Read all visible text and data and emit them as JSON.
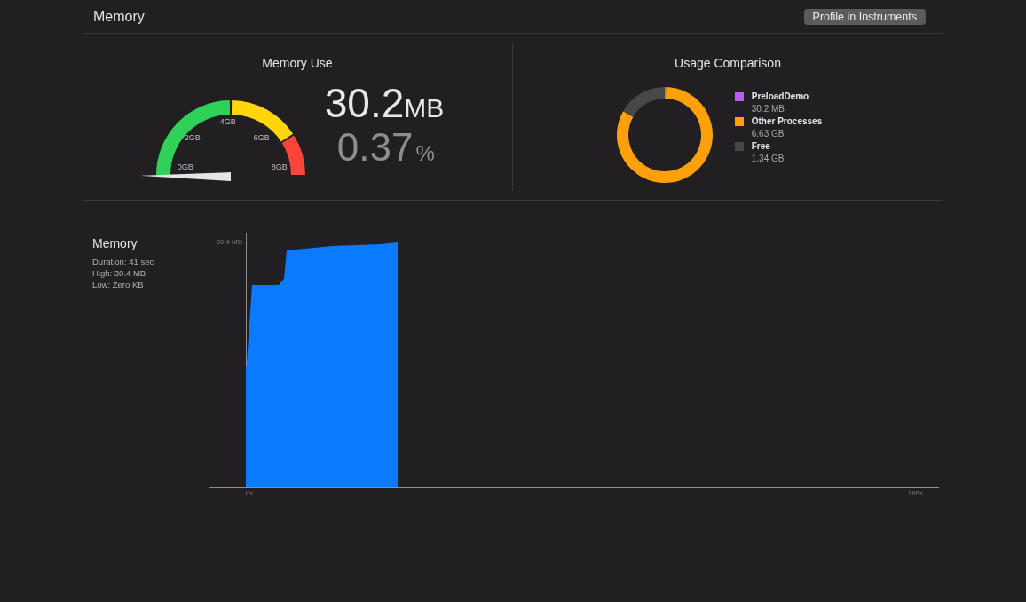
{
  "header": {
    "title": "Memory",
    "button": "Profile in Instruments"
  },
  "memory_use": {
    "title": "Memory Use",
    "gauge": {
      "level": 0.0037,
      "ticks": [
        "0GB",
        "2GB",
        "4GB",
        "6GB",
        "8GB"
      ]
    },
    "value": "30.2",
    "unit": "MB",
    "percent": "0.37",
    "percent_unit": "%"
  },
  "usage_comparison": {
    "title": "Usage Comparison",
    "chart_data": {
      "type": "donut",
      "categories": [
        "PreloadDemo",
        "Other Processes",
        "Free"
      ],
      "series": [
        {
          "values": [
            0.38,
            82.87,
            16.75
          ]
        }
      ]
    },
    "legend": [
      {
        "value": "30.2 MB",
        "color": "#bf5af2"
      },
      {
        "value": "6.63 GB",
        "color": "#ff9f0a"
      },
      {
        "value": "1.34 GB",
        "color": "#48484a"
      }
    ]
  },
  "timeline": {
    "title": "Memory",
    "details": [
      "Duration: 41 sec",
      "High: 30.4 MB",
      "Low: Zero KB"
    ],
    "graph": {
      "max_label": "30.4 MB",
      "start_label": "0s",
      "end_label": "186s"
    }
  }
}
